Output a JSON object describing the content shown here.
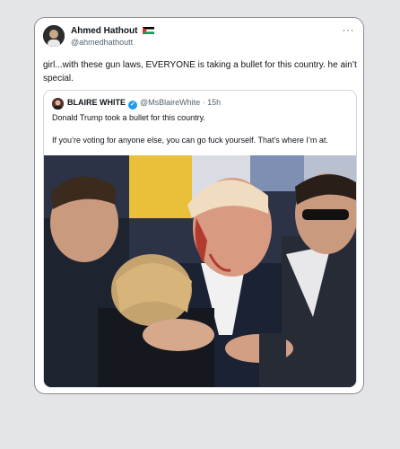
{
  "post": {
    "author_name": "Ahmed Hathout",
    "author_handle": "@ahmedhathoutt",
    "more_glyph": "···",
    "text": "girl...with these gun laws, EVERYONE is taking a bullet for this country. he ain’t special."
  },
  "quoted": {
    "author_name": "BLAIRE WHITE",
    "verified_glyph": "✓",
    "handle_time": "@MsBlaireWhite · 15h",
    "line1": "Donald Trump took a bullet for this country.",
    "line2": "If you’re voting for anyone else, you can go fuck yourself. That’s where I’m at."
  },
  "colors": {
    "background": "#e4e5e8",
    "card": "#ffffff",
    "text": "#0f1419",
    "muted": "#536471",
    "verified": "#1d9bf0"
  },
  "icons": [
    "more-icon",
    "verified-icon",
    "flag-icon"
  ]
}
